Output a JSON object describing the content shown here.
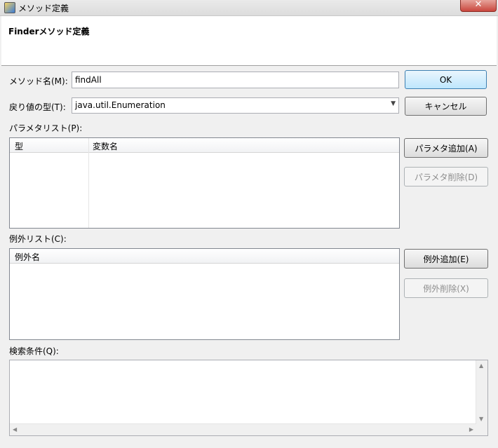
{
  "window": {
    "title": "メソッド定義",
    "close_label": "✕"
  },
  "header": {
    "title": "Finderメソッド定義"
  },
  "form": {
    "method_name_label": "メソッド名(M):",
    "method_name_value": "findAll",
    "return_type_label": "戻り値の型(T):",
    "return_type_value": "java.util.Enumeration",
    "param_list_label": "パラメタリスト(P):",
    "exception_list_label": "例外リスト(C):",
    "search_cond_label": "検索条件(Q):"
  },
  "param_table": {
    "columns": [
      "型",
      "変数名"
    ]
  },
  "exception_table": {
    "columns": [
      "例外名"
    ]
  },
  "buttons": {
    "ok": "OK",
    "cancel": "キャンセル",
    "param_add": "パラメタ追加(A)",
    "param_delete": "パラメタ削除(D)",
    "exception_add": "例外追加(E)",
    "exception_delete": "例外削除(X)"
  },
  "icons": {
    "app": "dialog-app-icon",
    "dropdown": "chevron-down-icon",
    "scroll_up": "scroll-up-arrow-icon",
    "scroll_down": "scroll-down-arrow-icon",
    "scroll_left": "scroll-left-arrow-icon",
    "scroll_right": "scroll-right-arrow-icon"
  }
}
